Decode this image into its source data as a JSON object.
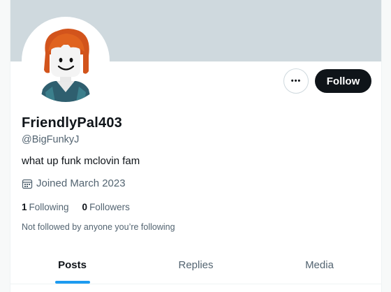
{
  "profile": {
    "display_name": "FriendlyPal403",
    "handle": "@BigFunkyJ",
    "bio": "what up funk mclovin fam",
    "joined": "Joined March 2023",
    "avatar_icon": "roblox-avatar-icon"
  },
  "actions": {
    "more_label": "•••",
    "follow_label": "Follow"
  },
  "stats": {
    "following_count": "1",
    "following_label": "Following",
    "followers_count": "0",
    "followers_label": "Followers"
  },
  "note": "Not followed by anyone you’re following",
  "tabs": [
    {
      "label": "Posts",
      "active": true
    },
    {
      "label": "Replies",
      "active": false
    },
    {
      "label": "Media",
      "active": false
    }
  ],
  "colors": {
    "accent": "#1d9bf0",
    "banner": "#cfd9de",
    "text_primary": "#0f1419",
    "text_secondary": "#536471"
  }
}
